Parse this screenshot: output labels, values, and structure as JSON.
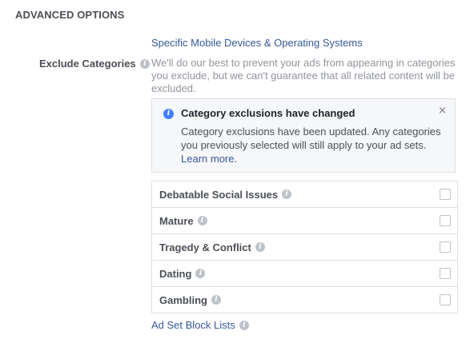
{
  "section": {
    "title": "ADVANCED OPTIONS"
  },
  "devices_link": "Specific Mobile Devices & Operating Systems",
  "exclude": {
    "label": "Exclude Categories",
    "description": "We'll do our best to prevent your ads from appearing in categories you exclude, but we can't guarantee that all related content will be excluded."
  },
  "notice": {
    "title": "Category exclusions have changed",
    "body": "Category exclusions have been updated. Any categories you previously selected will still apply to your ad sets.",
    "learn_more": "Learn more.",
    "close": "×",
    "accent_color": "#4080ff"
  },
  "categories": [
    {
      "label": "Debatable Social Issues",
      "checked": false
    },
    {
      "label": "Mature",
      "checked": false
    },
    {
      "label": "Tragedy & Conflict",
      "checked": false
    },
    {
      "label": "Dating",
      "checked": false
    },
    {
      "label": "Gambling",
      "checked": false
    }
  ],
  "block_lists": {
    "label": "Ad Set Block Lists"
  },
  "info_glyph": "i",
  "colors": {
    "link": "#365899",
    "label": "#4b4f56",
    "muted": "#90949c",
    "border": "#dddfe2"
  }
}
